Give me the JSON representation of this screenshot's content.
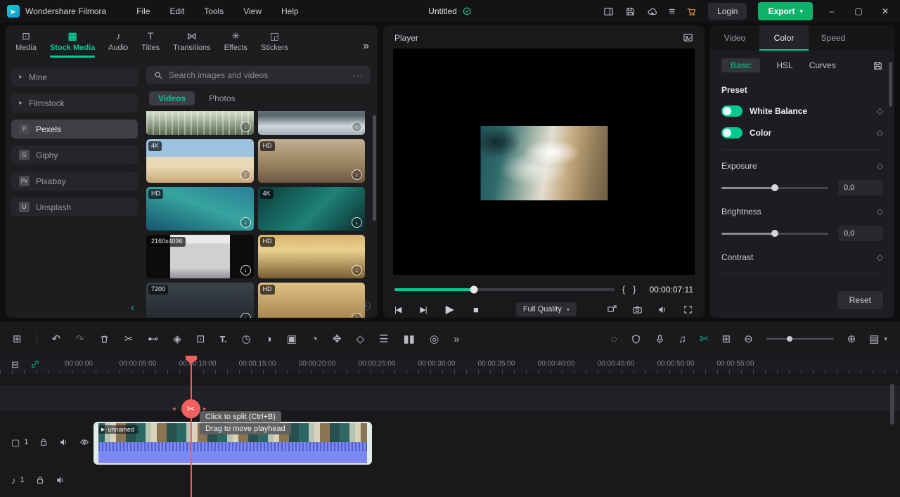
{
  "colors": {
    "accent": "#00ca92",
    "export_green": "#0bb268",
    "playhead": "#f15f5f",
    "audio_clip": "#7d89f3"
  },
  "titlebar": {
    "app_name": "Wondershare Filmora",
    "logo_play": "▶",
    "menus": [
      "File",
      "Edit",
      "Tools",
      "View",
      "Help"
    ],
    "project_name": "Untitled",
    "hamburger": "≡",
    "login": "Login",
    "export": "Export",
    "export_caret": "▾",
    "minimize": "–",
    "maximize": "▢",
    "close": "✕"
  },
  "media": {
    "tabs": [
      {
        "label": "Media",
        "icon": "⊡"
      },
      {
        "label": "Stock Media",
        "icon": "▦"
      },
      {
        "label": "Audio",
        "icon": "♪"
      },
      {
        "label": "Titles",
        "icon": "T"
      },
      {
        "label": "Transitions",
        "icon": "⋈"
      },
      {
        "label": "Effects",
        "icon": "✳"
      },
      {
        "label": "Stickers",
        "icon": "◲"
      }
    ],
    "more": "»",
    "sources": [
      {
        "label": "Mine",
        "icon": "▸"
      },
      {
        "label": "Filmstock",
        "icon": "▸"
      },
      {
        "label": "Pexels",
        "icon": "P"
      },
      {
        "label": "Giphy",
        "icon": "G"
      },
      {
        "label": "Pixabay",
        "icon": "Px"
      },
      {
        "label": "Unsplash",
        "icon": "U"
      }
    ],
    "search_placeholder": "Search images and videos",
    "overflow_dots": "···",
    "filters": {
      "videos": "Videos",
      "photos": "Photos"
    },
    "badges": {
      "t3": "4K",
      "t4": "HD",
      "t5": "HD",
      "t6": "4K",
      "t7": "2160x4096",
      "t8": "HD",
      "t9": "7200",
      "t10": "HD"
    },
    "download_glyph": "↓",
    "info_glyph": "ⓘ",
    "collapse_glyph": "‹"
  },
  "player": {
    "title": "Player",
    "timecode": "00:00:07:11",
    "quality": "Full Quality",
    "quality_caret": "▾",
    "mark_in": "{",
    "mark_out": "}",
    "prev": "|◀",
    "next": "▶|",
    "play": "▶",
    "stop": "■"
  },
  "props": {
    "tab_video": "Video",
    "tab_color": "Color",
    "tab_speed": "Speed",
    "sub_basic": "Basic",
    "sub_hsl": "HSL",
    "sub_curves": "Curves",
    "preset": "Preset",
    "white_balance": "White Balance",
    "color": "Color",
    "exposure": "Exposure",
    "brightness": "Brightness",
    "contrast": "Contrast",
    "exposure_value": "0,0",
    "brightness_value": "0,0",
    "reset": "Reset",
    "diamond": "◇"
  },
  "toolbar": {
    "workspace": "⊞",
    "undo": "↶",
    "redo": "↷",
    "scissors": "✂",
    "ripple": "⊷",
    "marker": "◈",
    "crop": "⊡",
    "text": "T.",
    "speed": "◷",
    "color": "◑",
    "motion": "▣",
    "timer": "◔",
    "fit": "✥",
    "keyframe": "◇",
    "adjust": "☰",
    "meter": "▮▮",
    "record": "◎",
    "more": "»",
    "render": "◌",
    "ducking": "♫",
    "autosplit": "✄",
    "addmarker": "⊞",
    "zoomout": "⊖",
    "zoomin": "⊕",
    "trackheight": "▤",
    "caret": "▾"
  },
  "timeline": {
    "ruler": [
      ":00:00:00",
      "00:00:05:00",
      "00:00:10:00",
      "00:00:15:00",
      "00:00:20:00",
      "00:00:25:00",
      "00:00:30:00",
      "00:00:35:00",
      "00:00:40:00",
      "00:00:45:00",
      "00:00:50:00",
      "00:00:55:00"
    ],
    "tip1": "Click to split (Ctrl+B)",
    "tip2": "Drag to move playhead",
    "clip_name": "unnamed",
    "label_icon": "▶",
    "organize": "⊟",
    "track_clip": "▢",
    "v_num": "1",
    "a_num": "1",
    "note": "♪",
    "scissors": "✂",
    "arrow_l": "◂",
    "arrow_r": "▸"
  }
}
